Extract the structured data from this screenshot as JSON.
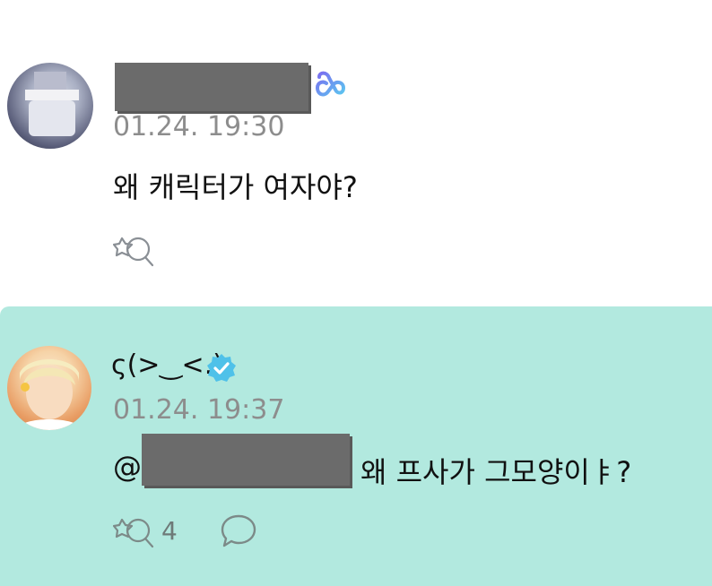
{
  "comments": [
    {
      "username": "",
      "badge_icon": "weverse-heart-icon",
      "timestamp": "01.24. 19:30",
      "text": "왜 캐릭터가 여자야?",
      "reaction_count": ""
    },
    {
      "username": "ς(>‿<.)",
      "badge_icon": "verified-check-icon",
      "timestamp": "01.24. 19:37",
      "mention_prefix": "@",
      "text": "왜 프사가 그모양이ㅑ?",
      "reaction_count": "4",
      "background_color": "#b2e9df"
    }
  ]
}
